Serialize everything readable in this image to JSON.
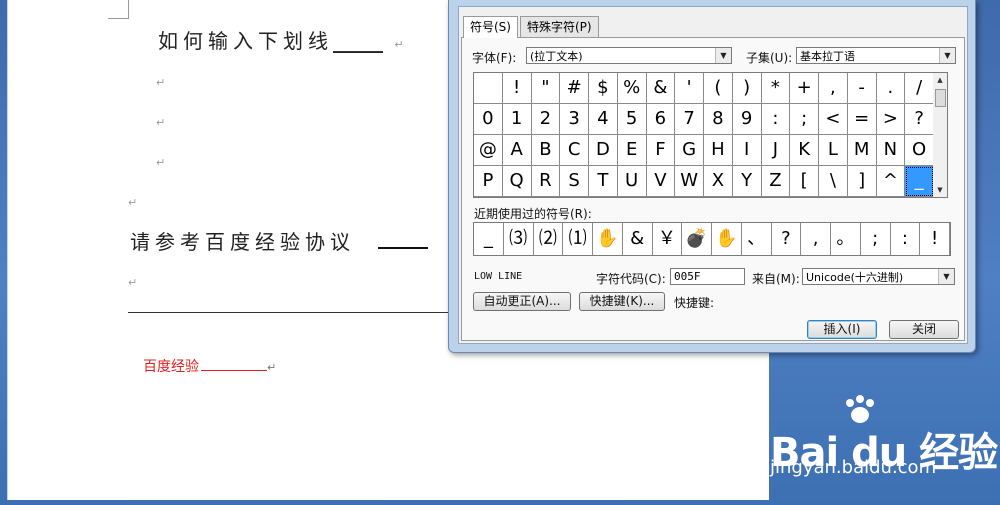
{
  "document": {
    "heading1": "如何输入下划线",
    "heading1_underline": "_____",
    "heading2": "请参考百度经验协议",
    "paragraph_mark": "↵",
    "red_text": "百度经验"
  },
  "dialog": {
    "tabs": [
      {
        "label": "符号(S)"
      },
      {
        "label": "特殊字符(P)"
      }
    ],
    "font_label": "字体(F):",
    "font_value": "(拉丁文本)",
    "subset_label": "子集(U):",
    "subset_value": "基本拉丁语",
    "symbols": [
      [
        " ",
        "!",
        "\"",
        "#",
        "$",
        "%",
        "&",
        "'",
        "(",
        ")",
        "*",
        "+",
        ",",
        "-",
        ".",
        "/"
      ],
      [
        "0",
        "1",
        "2",
        "3",
        "4",
        "5",
        "6",
        "7",
        "8",
        "9",
        ":",
        ";",
        "<",
        "=",
        ">",
        "?"
      ],
      [
        "@",
        "A",
        "B",
        "C",
        "D",
        "E",
        "F",
        "G",
        "H",
        "I",
        "J",
        "K",
        "L",
        "M",
        "N",
        "O"
      ],
      [
        "P",
        "Q",
        "R",
        "S",
        "T",
        "U",
        "V",
        "W",
        "X",
        "Y",
        "Z",
        "[",
        "\\",
        "]",
        "^",
        "_"
      ]
    ],
    "selected_symbol": "_",
    "recent_label": "近期使用过的符号(R):",
    "recent_symbols": [
      "_",
      "⑶",
      "⑵",
      "⑴",
      "✋",
      "&",
      "￥",
      "💣",
      "✋",
      "、",
      "?",
      ",",
      "。",
      ";",
      ":",
      "!"
    ],
    "char_name": "LOW LINE",
    "char_code_label": "字符代码(C):",
    "char_code_value": "005F",
    "from_label": "来自(M):",
    "from_value": "Unicode(十六进制)",
    "autocorrect_button": "自动更正(A)...",
    "shortcut_button": "快捷键(K)...",
    "shortcut_label": "快捷键:",
    "insert_button": "插入(I)",
    "close_button": "关闭"
  },
  "watermark": {
    "brand": "Bai du 经验",
    "url": "jingyan.baidu.com"
  }
}
